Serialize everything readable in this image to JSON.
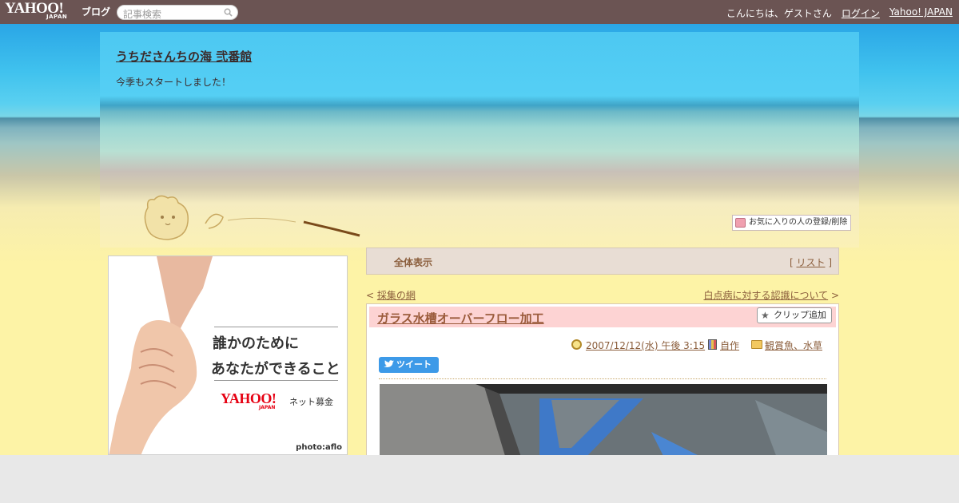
{
  "topbar": {
    "logo": "YAHOO!",
    "logo_sub": "JAPAN",
    "logo_blog": "ブログ",
    "search_placeholder": "記事検索",
    "greeting": "こんにちは、ゲストさん",
    "login": "ログイン",
    "yahoo_japan": "Yahoo! JAPAN"
  },
  "header": {
    "title": "うちださんちの海 弐番館",
    "subtitle": "今季もスタートしました！",
    "favorite_label": "お気に入りの人の登録/削除"
  },
  "ad": {
    "line1": "誰かのために",
    "line2": "あなたができること",
    "brand": "YAHOO!",
    "brand_sub": "JAPAN",
    "service": "ネット募金",
    "credit": "photo:aflo"
  },
  "category_bar": {
    "all_label": "全体表示",
    "list_open": "[ ",
    "list_label": "リスト",
    "list_close": " ]"
  },
  "nav": {
    "prev_arrow": "< ",
    "prev_label": "採集の網",
    "next_label": "白点病に対する認識について",
    "next_arrow": " >"
  },
  "entry": {
    "title": "ガラス水槽オーバーフロー加工",
    "clip_label": "クリップ追加",
    "date": "2007/12/12(水) 午後 3:15",
    "category1": "自作",
    "category2": "観賞魚、水草",
    "tweet_label": "ツイート"
  }
}
